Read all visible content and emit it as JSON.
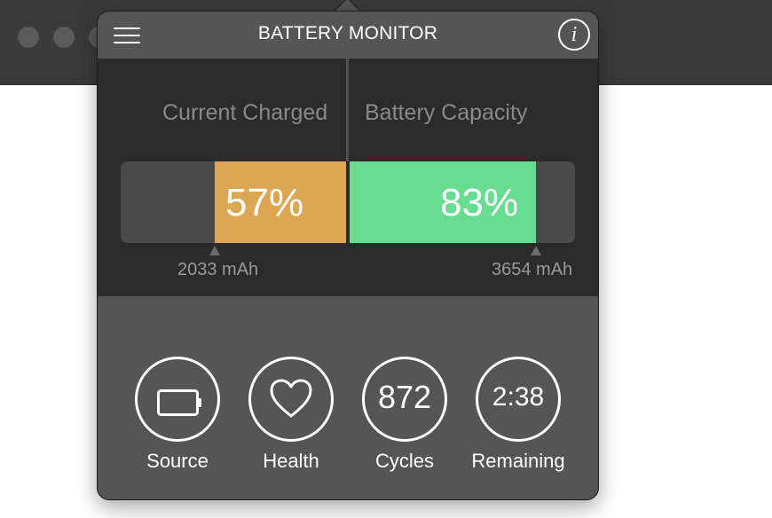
{
  "popover": {
    "title": "BATTERY MONITOR",
    "menu_icon": "hamburger-menu-icon",
    "info_icon": "info-icon",
    "info_glyph": "i"
  },
  "charge": {
    "current_label": "Current Charged",
    "capacity_label": "Battery Capacity",
    "current_percent": 57,
    "current_text": "57%",
    "capacity_percent": 83,
    "capacity_text": "83%",
    "current_mah": "2033 mAh",
    "capacity_mah": "3654 mAh",
    "current_color": "#dba753",
    "capacity_color": "#68dd92"
  },
  "stats": [
    {
      "label": "Source",
      "icon": "battery-icon"
    },
    {
      "label": "Health",
      "icon": "heart-icon"
    },
    {
      "label": "Cycles",
      "value": "872"
    },
    {
      "label": "Remaining",
      "value": "2:38"
    }
  ]
}
